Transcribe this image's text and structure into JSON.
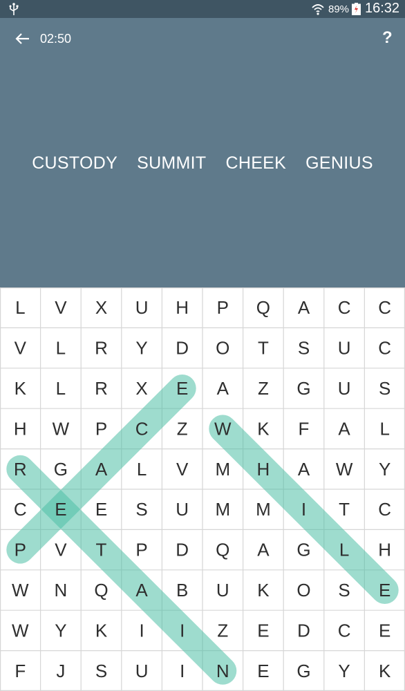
{
  "status_bar": {
    "battery": "89%",
    "time": "16:32",
    "icons": [
      "usb-icon",
      "wifi-icon",
      "battery-icon"
    ]
  },
  "header": {
    "timer": "02:50",
    "help": "?",
    "back_icon": "arrow-left-icon"
  },
  "words": [
    "CUSTODY",
    "SUMMIT",
    "CHEEK",
    "GENIUS"
  ],
  "grid": {
    "rows": [
      [
        "L",
        "V",
        "X",
        "U",
        "H",
        "P",
        "Q",
        "A",
        "C",
        "C"
      ],
      [
        "V",
        "L",
        "R",
        "Y",
        "D",
        "O",
        "T",
        "S",
        "U",
        "C"
      ],
      [
        "K",
        "L",
        "R",
        "X",
        "E",
        "A",
        "Z",
        "G",
        "U",
        "S"
      ],
      [
        "H",
        "W",
        "P",
        "C",
        "Z",
        "W",
        "K",
        "F",
        "A",
        "L"
      ],
      [
        "R",
        "G",
        "A",
        "L",
        "V",
        "M",
        "H",
        "A",
        "W",
        "Y"
      ],
      [
        "C",
        "E",
        "E",
        "S",
        "U",
        "M",
        "M",
        "I",
        "T",
        "C"
      ],
      [
        "P",
        "V",
        "T",
        "P",
        "D",
        "Q",
        "A",
        "G",
        "L",
        "H"
      ],
      [
        "W",
        "N",
        "Q",
        "A",
        "B",
        "U",
        "K",
        "O",
        "S",
        "E"
      ],
      [
        "W",
        "Y",
        "K",
        "I",
        "I",
        "Z",
        "E",
        "D",
        "C",
        "E"
      ],
      [
        "F",
        "J",
        "S",
        "U",
        "I",
        "N",
        "E",
        "G",
        "Y",
        "K"
      ]
    ],
    "found_words": [
      {
        "word": "PEACE",
        "start": [
          6,
          0
        ],
        "end": [
          2,
          4
        ]
      },
      {
        "word": "RETAIN",
        "start": [
          4,
          0
        ],
        "end": [
          9,
          5
        ]
      },
      {
        "word": "WHILE",
        "start": [
          3,
          5
        ],
        "end": [
          7,
          9
        ]
      }
    ],
    "highlight_color": "#4fbfa5",
    "letter_color": "#2e2e2e",
    "line_color": "#d6d6d6"
  },
  "colors": {
    "header_bg": "#5f7a8b",
    "status_bg": "#3f5563",
    "grid_bg": "#ffffff"
  }
}
